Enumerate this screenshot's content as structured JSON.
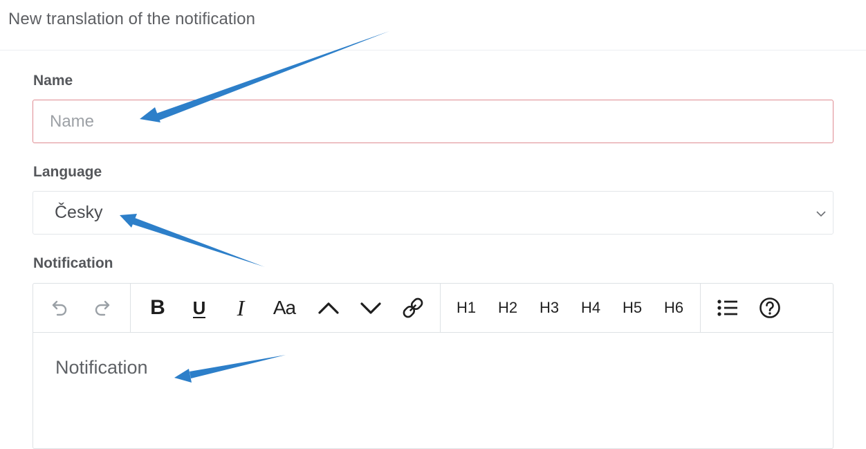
{
  "header": {
    "title": "New translation of the notification"
  },
  "form": {
    "name": {
      "label": "Name",
      "placeholder": "Name",
      "value": ""
    },
    "language": {
      "label": "Language",
      "selected": "Česky"
    },
    "notification": {
      "label": "Notification",
      "content": "Notification"
    }
  },
  "toolbar": {
    "underline": "U",
    "bold": "B",
    "italic": "I",
    "font_size": "Aa",
    "headings": [
      "H1",
      "H2",
      "H3",
      "H4",
      "H5",
      "H6"
    ]
  },
  "colors": {
    "error_border": "#df8b91",
    "annotation_arrow": "#2d7fc9",
    "label": "#55575b"
  },
  "icons": [
    "undo-icon",
    "redo-icon",
    "bold-icon",
    "underline-icon",
    "italic-icon",
    "font-size-icon",
    "superscript-icon",
    "subscript-icon",
    "link-icon",
    "bullet-list-icon",
    "help-icon",
    "chevron-down-icon"
  ]
}
